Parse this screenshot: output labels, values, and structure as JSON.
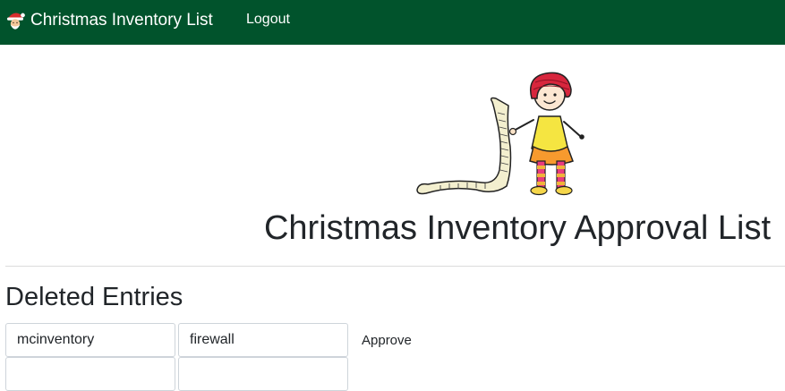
{
  "navbar": {
    "brand_icon": "santa-face-icon",
    "brand_text": "Christmas Inventory List",
    "logout_label": "Logout",
    "background_color": "#01532c"
  },
  "main": {
    "illustration": "elf-with-scroll-list-illustration",
    "title": "Christmas Inventory Approval List"
  },
  "deleted_entries": {
    "heading": "Deleted Entries",
    "rows": [
      {
        "user": "mcinventory",
        "item": "firewall",
        "action_label": "Approve"
      },
      {
        "user": "",
        "item": "",
        "action_label": ""
      }
    ]
  }
}
